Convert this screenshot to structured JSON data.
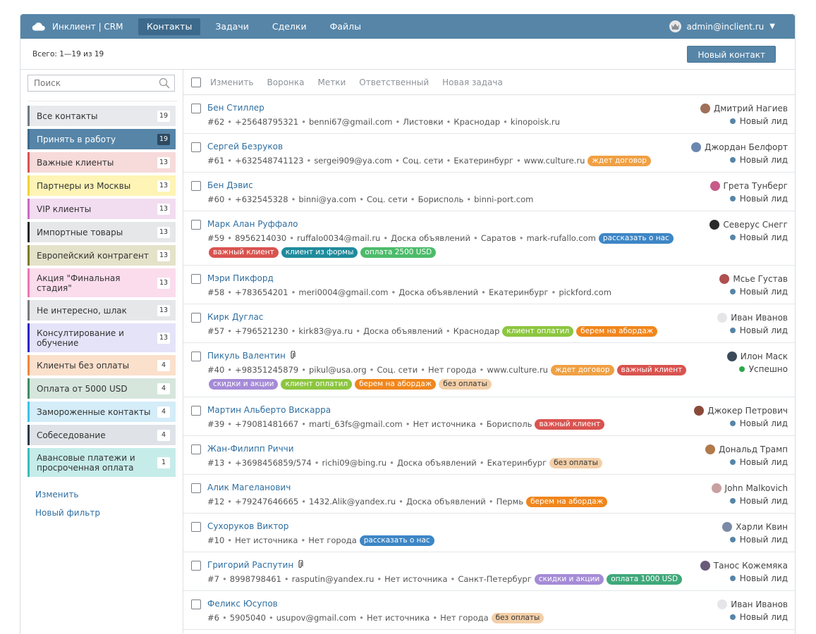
{
  "header": {
    "brand": "Инклиент | CRM",
    "nav": [
      "Контакты",
      "Задачи",
      "Сделки",
      "Файлы"
    ],
    "user": "admin@inclient.ru"
  },
  "subheader": {
    "total": "Всего: 1—19 из 19",
    "new_contact": "Новый контакт"
  },
  "search": {
    "placeholder": "Поиск"
  },
  "filters": [
    {
      "label": "Все контакты",
      "count": "19",
      "color": "#e7e9ec",
      "border": "#6f7b87"
    },
    {
      "label": "Принять в работу",
      "count": "19",
      "color": "#5685a8",
      "border": "#3d6a8c",
      "active": true
    },
    {
      "label": "Важные клиенты",
      "count": "13",
      "color": "#f7dada",
      "border": "#d9534f"
    },
    {
      "label": "Партнеры из Москвы",
      "count": "13",
      "color": "#fdf4b5",
      "border": "#f0d23b"
    },
    {
      "label": "VIP клиенты",
      "count": "13",
      "color": "#f2dcf0",
      "border": "#c869c2"
    },
    {
      "label": "Импортные товары",
      "count": "13",
      "color": "#e6e7e9",
      "border": "#222222"
    },
    {
      "label": "Европейский контрагент",
      "count": "13",
      "color": "#e4e2c9",
      "border": "#7b7a2a"
    },
    {
      "label": "Акция \"Финальная стадия\"",
      "count": "13",
      "color": "#fbdcec",
      "border": "#ee76b4"
    },
    {
      "label": "Не интересно, шлак",
      "count": "13",
      "color": "#e6e7e9",
      "border": "#7a7a7a"
    },
    {
      "label": "Консултирование и обучение",
      "count": "13",
      "color": "#e5e3f8",
      "border": "#2a22c8"
    },
    {
      "label": "Клиенты без оплаты",
      "count": "4",
      "color": "#fbe0cc",
      "border": "#f0863b"
    },
    {
      "label": "Оплата от 5000 USD",
      "count": "4",
      "color": "#d6e6dd",
      "border": "#3f8c64"
    },
    {
      "label": "Замороженные контакты",
      "count": "4",
      "color": "#d4edf8",
      "border": "#3ec1ec"
    },
    {
      "label": "Собеседование",
      "count": "4",
      "color": "#dfe3e7",
      "border": "#2b3a4a"
    },
    {
      "label": "Авансовые платежи и просроченная оплата",
      "count": "1",
      "color": "#c6ecea",
      "border": "#3ebdb6"
    }
  ],
  "sidebar_links": {
    "edit": "Изменить",
    "new_filter": "Новый фильтр"
  },
  "toolbar": [
    "Изменить",
    "Воронка",
    "Метки",
    "Ответственный",
    "Новая задача"
  ],
  "contacts": [
    {
      "name": "Бен Стиллер",
      "meta": [
        "#62",
        "+25648795321",
        "benni67@gmail.com",
        "Листовки",
        "Краснодар",
        "kinopoisk.ru"
      ],
      "inline_tags": [],
      "tags": [],
      "owner": "Дмитрий Нагиев",
      "owner_color": "#a0705a",
      "status": "Новый лид",
      "status_color": "#5685a8"
    },
    {
      "name": "Сергей Безруков",
      "meta": [
        "#61",
        "+632548741123",
        "sergei909@ya.com",
        "Соц. сети",
        "Екатеринбург",
        "www.culture.ru"
      ],
      "inline_tags": [
        {
          "t": "ждет договор",
          "c": "#f0a043"
        }
      ],
      "tags": [],
      "owner": "Джордан Белфорт",
      "owner_color": "#6a87b0",
      "status": "Новый лид",
      "status_color": "#5685a8"
    },
    {
      "name": "Бен Дэвис",
      "meta": [
        "#60",
        "+632545328",
        "binni@ya.com",
        "Соц. сети",
        "Борисполь",
        "binni-port.com"
      ],
      "inline_tags": [],
      "tags": [],
      "owner": "Грета Тунберг",
      "owner_color": "#c85a8a",
      "status": "Новый лид",
      "status_color": "#5685a8"
    },
    {
      "name": "Марк Алан Руффало",
      "meta": [
        "#59",
        "8956214030",
        "ruffalo0034@mail.ru",
        "Доска объявлений",
        "Саратов",
        "mark-rufallo.com"
      ],
      "inline_tags": [
        {
          "t": "рассказать о нас",
          "c": "#3d86c6"
        }
      ],
      "tags": [
        {
          "t": "важный клиент",
          "c": "#d9534f"
        },
        {
          "t": "клиент из формы",
          "c": "#1f8b9c"
        },
        {
          "t": "оплата 2500 USD",
          "c": "#4cbb6a"
        }
      ],
      "owner": "Северус Снегг",
      "owner_color": "#2a2a2a",
      "status": "Новый лид",
      "status_color": "#5685a8"
    },
    {
      "name": "Мэри Пикфорд",
      "meta": [
        "#58",
        "+783654201",
        "meri0004@gmail.com",
        "Доска объявлений",
        "Екатеринбург",
        "pickford.com"
      ],
      "inline_tags": [],
      "tags": [],
      "owner": "Мсье Густав",
      "owner_color": "#b05050",
      "status": "Новый лид",
      "status_color": "#5685a8"
    },
    {
      "name": "Кирк Дуглас",
      "meta": [
        "#57",
        "+796521230",
        "kirk83@ya.ru",
        "Доска объявлений",
        "Краснодар"
      ],
      "inline_tags": [
        {
          "t": "клиент оплатил",
          "c": "#8cc63f"
        },
        {
          "t": "берем на абордаж",
          "c": "#f0861d"
        }
      ],
      "tags": [],
      "owner": "Иван Иванов",
      "owner_color": "#e6e6e8",
      "status": "Новый лид",
      "status_color": "#5685a8"
    },
    {
      "name": "Пикуль Валентин",
      "clip": true,
      "meta": [
        "#40",
        "+98351245879",
        "pikul@usa.org",
        "Соц. сети",
        "Нет города",
        "www.culture.ru"
      ],
      "inline_tags": [
        {
          "t": "ждет договор",
          "c": "#f0a043"
        },
        {
          "t": "важный клиент",
          "c": "#d9534f"
        }
      ],
      "tags": [
        {
          "t": "скидки и акции",
          "c": "#a58bd6"
        },
        {
          "t": "клиент оплатил",
          "c": "#8cc63f"
        },
        {
          "t": "берем на абордаж",
          "c": "#f0861d"
        },
        {
          "t": "без оплаты",
          "c": "#f3cfa8",
          "dark": true
        }
      ],
      "owner": "Илон Маск",
      "owner_color": "#3a4a5a",
      "status": "Успешно",
      "status_color": "#2aa84a"
    },
    {
      "name": "Мартин Альберто Вискарра",
      "meta": [
        "#39",
        "+79081481667",
        "marti_63fs@gmail.com",
        "Нет источника",
        "Борисполь"
      ],
      "inline_tags": [
        {
          "t": "важный клиент",
          "c": "#d9534f"
        }
      ],
      "tags": [],
      "owner": "Джокер Петрович",
      "owner_color": "#8a4a3a",
      "status": "Новый лид",
      "status_color": "#5685a8"
    },
    {
      "name": "Жан-Филипп Риччи",
      "meta": [
        "#13",
        "+3698456859/574",
        "richi09@bing.ru",
        "Доска объявлений",
        "Екатеринбург"
      ],
      "inline_tags": [
        {
          "t": "без оплаты",
          "c": "#f3cfa8",
          "dark": true
        }
      ],
      "tags": [],
      "owner": "Дональд Трамп",
      "owner_color": "#b07a4a",
      "status": "Новый лид",
      "status_color": "#5685a8"
    },
    {
      "name": "Алик Магеланович",
      "meta": [
        "#12",
        "+79247646665",
        "1432.Alik@yandex.ru",
        "Доска объявлений",
        "Пермь"
      ],
      "inline_tags": [
        {
          "t": "берем на абордаж",
          "c": "#f0861d"
        }
      ],
      "tags": [],
      "owner": "John Malkovich",
      "owner_color": "#c8a0a0",
      "status": "Новый лид",
      "status_color": "#5685a8"
    },
    {
      "name": "Сухоруков Виктор",
      "meta": [
        "#10",
        "Нет источника",
        "Нет города"
      ],
      "inline_tags": [
        {
          "t": "рассказать о нас",
          "c": "#3d86c6"
        }
      ],
      "tags": [],
      "owner": "Харли Квин",
      "owner_color": "#7a8aa8",
      "status": "Новый лид",
      "status_color": "#5685a8"
    },
    {
      "name": "Григорий Распутин",
      "clip": true,
      "meta": [
        "#7",
        "8998798461",
        "rasputin@yandex.ru",
        "Нет источника",
        "Санкт-Петербург"
      ],
      "inline_tags": [
        {
          "t": "скидки и акции",
          "c": "#a58bd6"
        },
        {
          "t": "оплата 1000 USD",
          "c": "#3fa87a"
        }
      ],
      "tags": [],
      "owner": "Танос Кожемяка",
      "owner_color": "#6a5a7a",
      "status": "Новый лид",
      "status_color": "#5685a8"
    },
    {
      "name": "Феликс Юсупов",
      "meta": [
        "#6",
        "5905040",
        "usupov@gmail.com",
        "Нет источника",
        "Нет города"
      ],
      "inline_tags": [
        {
          "t": "без оплаты",
          "c": "#f3cfa8",
          "dark": true
        }
      ],
      "tags": [],
      "owner": "Иван Иванов",
      "owner_color": "#e6e6e8",
      "status": "Новый лид",
      "status_color": "#5685a8"
    }
  ]
}
